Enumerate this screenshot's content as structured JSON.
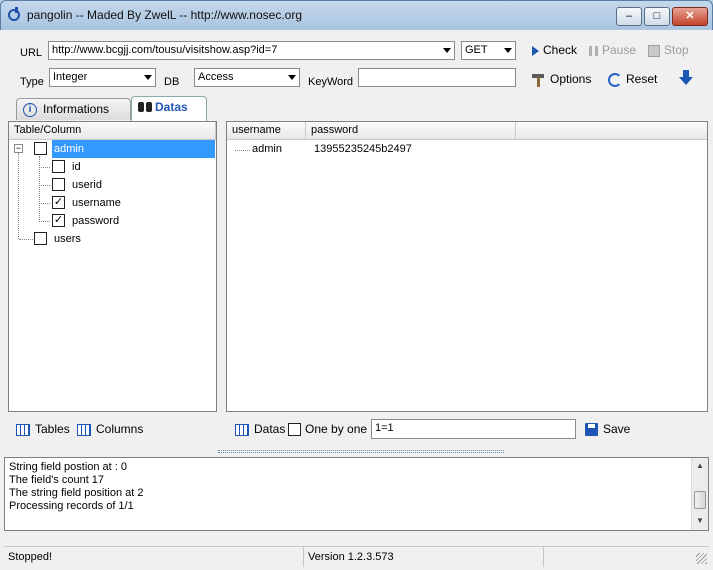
{
  "window": {
    "title": "pangolin -- Maded By ZwelL -- http://www.nosec.org",
    "min": "–",
    "max": "□",
    "close": "✕"
  },
  "toolbar": {
    "url_label": "URL",
    "url_value": "http://www.bcgjj.com/tousu/visitshow.asp?id=7",
    "method": "GET",
    "check": "Check",
    "pause": "Pause",
    "stop": "Stop",
    "type_label": "Type",
    "type_value": "Integer",
    "db_label": "DB",
    "db_value": "Access",
    "keyword_label": "KeyWord",
    "keyword_value": "",
    "options": "Options",
    "reset": "Reset"
  },
  "tabs": [
    {
      "label": "Informations"
    },
    {
      "label": "Datas"
    }
  ],
  "tree": {
    "header": "Table/Column",
    "tables": [
      {
        "name": "admin",
        "checked": false,
        "selected": true,
        "columns": [
          {
            "name": "id",
            "checked": false
          },
          {
            "name": "userid",
            "checked": false
          },
          {
            "name": "username",
            "checked": true
          },
          {
            "name": "password",
            "checked": true
          }
        ]
      },
      {
        "name": "users",
        "checked": false
      }
    ]
  },
  "results": {
    "columns": [
      "username",
      "password"
    ],
    "rows": [
      [
        "admin",
        "13955235245b2497"
      ]
    ]
  },
  "left_bottom": {
    "tables": "Tables",
    "columns": "Columns"
  },
  "right_bottom": {
    "datas": "Datas",
    "one_by_one": "One by one",
    "condition": "1=1",
    "save": "Save"
  },
  "log": [
    "String field postion at : 0",
    "The field's count 17",
    "The string field position at 2",
    "Processing records of 1/1"
  ],
  "status": {
    "left": "Stopped!",
    "version": "Version  1.2.3.573"
  },
  "colors": {
    "accent": "#1d55b5",
    "selection": "#3399ff"
  }
}
